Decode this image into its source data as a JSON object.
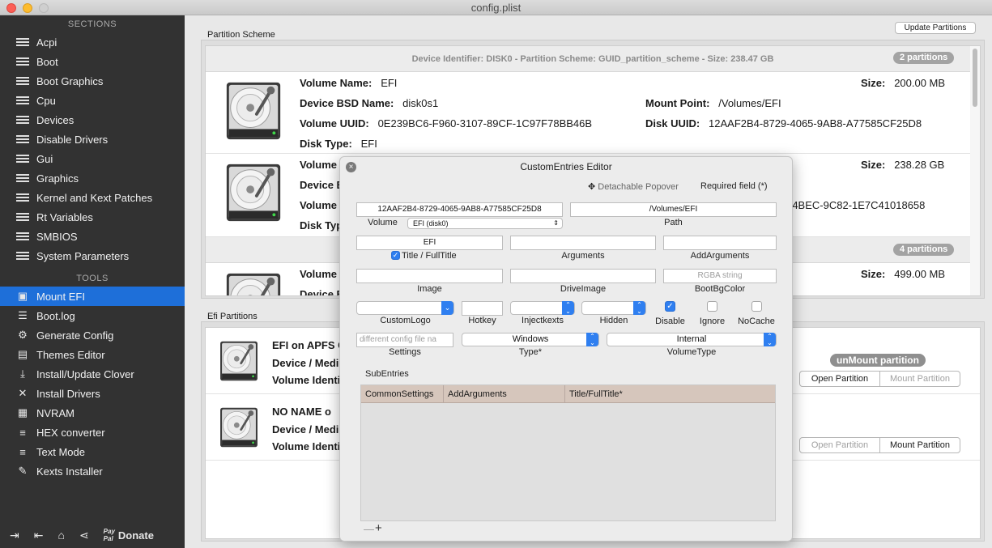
{
  "window": {
    "title": "config.plist"
  },
  "sidebar": {
    "sections_header": "SECTIONS",
    "sections": [
      {
        "label": "Acpi",
        "icon": "list-icon"
      },
      {
        "label": "Boot",
        "icon": "list-icon"
      },
      {
        "label": "Boot Graphics",
        "icon": "list-icon"
      },
      {
        "label": "Cpu",
        "icon": "list-icon"
      },
      {
        "label": "Devices",
        "icon": "list-icon"
      },
      {
        "label": "Disable Drivers",
        "icon": "list-icon"
      },
      {
        "label": "Gui",
        "icon": "list-icon"
      },
      {
        "label": "Graphics",
        "icon": "list-icon"
      },
      {
        "label": "Kernel and Kext Patches",
        "icon": "list-icon"
      },
      {
        "label": "Rt Variables",
        "icon": "list-icon"
      },
      {
        "label": "SMBIOS",
        "icon": "list-icon"
      },
      {
        "label": "System Parameters",
        "icon": "list-icon"
      }
    ],
    "tools_header": "TOOLS",
    "tools": [
      {
        "label": "Mount EFI",
        "icon": "disk-icon",
        "selected": true
      },
      {
        "label": "Boot.log",
        "icon": "log-icon"
      },
      {
        "label": "Generate Config",
        "icon": "gears-icon"
      },
      {
        "label": "Themes Editor",
        "icon": "theme-icon"
      },
      {
        "label": "Install/Update Clover",
        "icon": "install-icon"
      },
      {
        "label": "Install Drivers",
        "icon": "tools-icon"
      },
      {
        "label": "NVRAM",
        "icon": "chip-icon"
      },
      {
        "label": "HEX converter",
        "icon": "hex-icon"
      },
      {
        "label": "Text Mode",
        "icon": "text-icon"
      },
      {
        "label": "Kexts Installer",
        "icon": "kext-icon"
      }
    ],
    "footer": {
      "donate": "Donate",
      "paypal": "Pay\nPal"
    }
  },
  "partition_scheme": {
    "label": "Partition Scheme",
    "update_button": "Update Partitions",
    "disk0_header": "Device Identifier: DISK0 - Partition Scheme: GUID_partition_scheme - Size: 238.47 GB",
    "disk0_pill": "2 partitions",
    "disk1_pill": "4 partitions",
    "rows": [
      {
        "volume_name_k": "Volume Name:",
        "volume_name_v": "EFI",
        "bsd_k": "Device BSD Name:",
        "bsd_v": "disk0s1",
        "uuid_k": "Volume UUID:",
        "uuid_v": "0E239BC6-F960-3107-89CF-1C97F78BB46B",
        "type_k": "Disk Type:",
        "type_v": "EFI",
        "size_k": "Size:",
        "size_v": "200.00 MB",
        "mount_k": "Mount Point:",
        "mount_v": "/Volumes/EFI",
        "disk_uuid_k": "Disk UUID:",
        "disk_uuid_v": "12AAF2B4-8729-4065-9AB8-A77585CF25D8"
      },
      {
        "volume_name_k": "Volume",
        "bsd_k": "Device B",
        "uuid_k": "Volume",
        "type_k": "Disk Typ",
        "size_k": "Size:",
        "size_v": "238.28 GB",
        "disk_uuid_v": "-4BEC-9C82-1E7C41018658"
      },
      {
        "volume_name_k": "Volume",
        "bsd_k": "Device B",
        "size_k": "Size:",
        "size_v": "499.00 MB"
      }
    ]
  },
  "efi_partitions": {
    "label": "Efi Partitions",
    "unmount": "unMount partition",
    "rows": [
      {
        "name": "EFI on APFS C",
        "device": "Device / Medi",
        "volume": "Volume Identi",
        "open": "Open Partition",
        "mount": "Mount Partition"
      },
      {
        "name": "NO NAME o",
        "device": "Device / Medi",
        "volume": "Volume Identi",
        "open": "Open Partition",
        "mount": "Mount Partition"
      }
    ]
  },
  "popover": {
    "title": "CustomEntries Editor",
    "detachable": "Detachable Popover",
    "required": "Required field (*)",
    "volume_value": "12AAF2B4-8729-4065-9AB8-A77585CF25D8",
    "volume_label": "Volume",
    "volume_popup": "EFI (disk0)",
    "path_value": "/Volumes/EFI",
    "path_label": "Path",
    "title_value": "EFI",
    "title_label": "Title / FullTitle",
    "arguments_label": "Arguments",
    "addarguments_label": "AddArguments",
    "image_label": "Image",
    "driveimage_label": "DriveImage",
    "bootbg_placeholder": "RGBA string",
    "bootbg_label": "BootBgColor",
    "customlogo_label": "CustomLogo",
    "hotkey_label": "Hotkey",
    "injectkexts_label": "Injectkexts",
    "hidden_label": "Hidden",
    "disable_label": "Disable",
    "ignore_label": "Ignore",
    "nocache_label": "NoCache",
    "settings_placeholder": "different config file na",
    "settings_label": "Settings",
    "type_value": "Windows",
    "type_label": "Type*",
    "volumetype_value": "Internal",
    "volumetype_label": "VolumeType",
    "subentries_label": "SubEntries",
    "sub_columns": [
      "CommonSettings",
      "AddArguments",
      "Title/FullTitle*"
    ],
    "minus": "—",
    "plus": "+"
  },
  "colors": {
    "accent": "#1e6fd9",
    "sidebar_bg": "#323232",
    "sub_header": "#d6c6bc"
  }
}
